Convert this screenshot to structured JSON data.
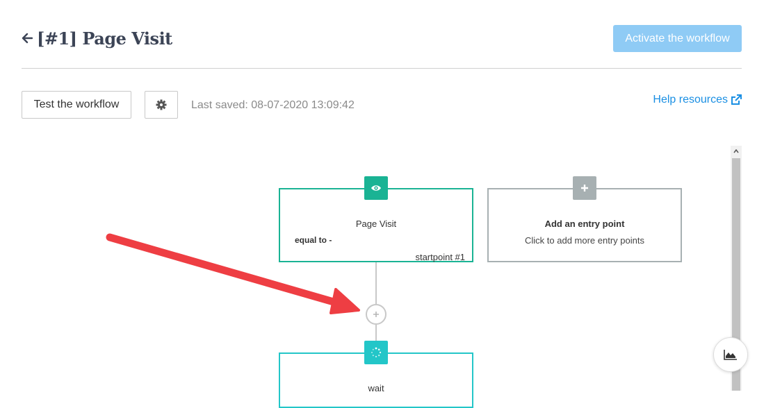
{
  "header": {
    "title": "[#1] Page Visit",
    "activate_label": "Activate the workflow"
  },
  "toolbar": {
    "test_label": "Test the workflow",
    "last_saved": "Last saved: 08-07-2020 13:09:42",
    "help_label": "Help resources"
  },
  "workflow": {
    "trigger": {
      "title": "Page Visit",
      "condition": "equal to -",
      "startpoint": "startpoint #1"
    },
    "entry": {
      "title": "Add an entry point",
      "subtitle": "Click to add more entry points"
    },
    "wait": {
      "title": "wait"
    }
  },
  "colors": {
    "trigger": "#1ab394",
    "wait": "#23c6c8",
    "entry": "#a7b0b2",
    "accent": "#1a8fe3",
    "annotation": "#ee3e43"
  }
}
